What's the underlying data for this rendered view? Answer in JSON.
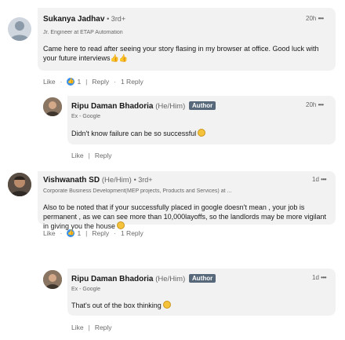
{
  "comments": [
    {
      "name": "Sukanya Jadhav",
      "degree": "• 3rd+",
      "headline": "Jr. Engineer at ETAP Automation",
      "time": "20h",
      "more": "•••",
      "text": "Came here to read after seeing your story flasing in my browser at office. Good luck with your future interviews",
      "like": "Like",
      "reactions": "1",
      "reply": "Reply",
      "replies": "1 Reply",
      "reply_item": {
        "name": "Ripu Daman Bhadoria",
        "pronoun": "(He/Him)",
        "badge": "Author",
        "headline": "Ex - Google",
        "time": "20h",
        "more": "•••",
        "text": "Didn't know failure can be so successful",
        "like": "Like",
        "reply": "Reply"
      }
    },
    {
      "name": "Vishwanath SD",
      "pronoun": "(He/Him)",
      "degree": "• 3rd+",
      "headline": "Corporate Business Development(MEP projects, Products and Services) at ...",
      "time": "1d",
      "more": "•••",
      "text": "Also to be noted that if your successfully placed in google doesn't mean , your job is permanent , as we can see more than 10,000layoffs, so the landlords may be more vigilant in giving you the house",
      "like": "Like",
      "reactions": "1",
      "reply": "Reply",
      "replies": "1 Reply",
      "reply_item": {
        "name": "Ripu Daman Bhadoria",
        "pronoun": "(He/Him)",
        "badge": "Author",
        "headline": "Ex - Google",
        "time": "1d",
        "more": "•••",
        "text": "That's out of the box thinking",
        "like": "Like",
        "reply": "Reply"
      }
    }
  ]
}
